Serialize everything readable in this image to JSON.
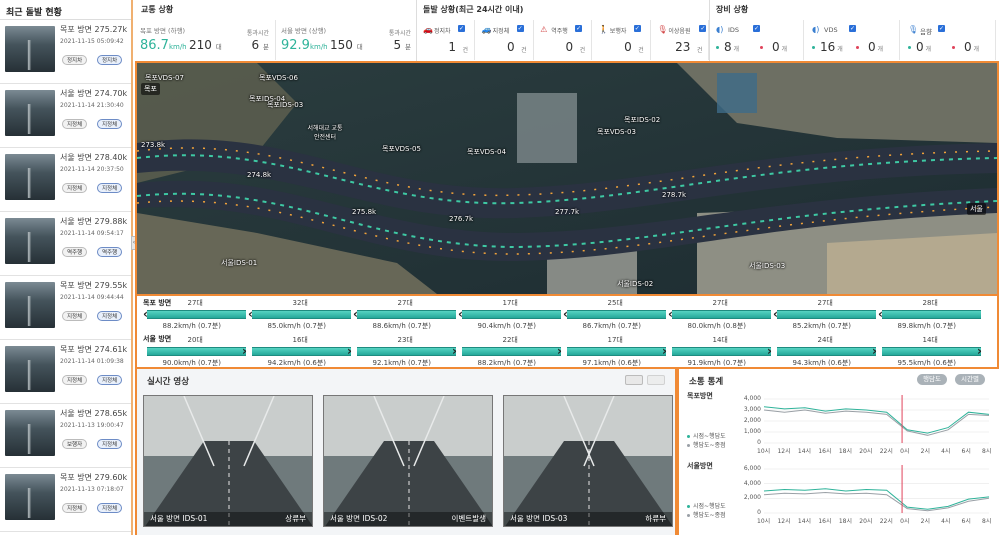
{
  "left_panel": {
    "title": "최근 돌발 현황",
    "incidents": [
      {
        "title": "목포 방면 275.27k",
        "date": "2021-11-15 05:09:42",
        "tags": [
          "정지차",
          "정지차"
        ]
      },
      {
        "title": "서울 방면 274.70k",
        "date": "2021-11-14 21:30:40",
        "tags": [
          "지정체",
          "지정체"
        ]
      },
      {
        "title": "서울 방면 278.40k",
        "date": "2021-11-14 20:37:50",
        "tags": [
          "지정체",
          "지정체"
        ]
      },
      {
        "title": "서울 방면 279.88k",
        "date": "2021-11-14 09:54:17",
        "tags": [
          "역주행",
          "역주행"
        ]
      },
      {
        "title": "목포 방면 279.55k",
        "date": "2021-11-14 09:44:44",
        "tags": [
          "지정체",
          "지정체"
        ]
      },
      {
        "title": "목포 방면 274.61k",
        "date": "2021-11-14 01:09:38",
        "tags": [
          "지정체",
          "지정체"
        ]
      },
      {
        "title": "서울 방면 278.65k",
        "date": "2021-11-13 19:00:47",
        "tags": [
          "보행자",
          "지정체"
        ]
      },
      {
        "title": "목포 방면 279.60k",
        "date": "2021-11-13 07:18:07",
        "tags": [
          "지정체",
          "지정체"
        ]
      }
    ]
  },
  "traffic": {
    "title": "교통 상황",
    "mokpo": {
      "label": "목포 방면 (하행)",
      "speed": "86.7",
      "speed_unit": "km/h",
      "count": "210",
      "count_unit": "대",
      "time_label": "통과시간",
      "time": "6",
      "time_unit": "분"
    },
    "seoul": {
      "label": "서울 방면 (상행)",
      "speed": "92.9",
      "speed_unit": "km/h",
      "count": "150",
      "count_unit": "대",
      "time_label": "통과시간",
      "time": "5",
      "time_unit": "분"
    }
  },
  "incidents_summary": {
    "title": "돌발 상황(최근 24시간 이내)",
    "items": [
      {
        "label": "정지차",
        "icon": "car-icon",
        "value": "1",
        "unit": "건"
      },
      {
        "label": "지정체",
        "icon": "traffic-jam-icon",
        "value": "0",
        "unit": "건"
      },
      {
        "label": "역주행",
        "icon": "warning-icon",
        "value": "0",
        "unit": "건"
      },
      {
        "label": "보행자",
        "icon": "pedestrian-icon",
        "value": "0",
        "unit": "건"
      },
      {
        "label": "이상음원",
        "icon": "microphone-icon",
        "value": "23",
        "unit": "건"
      }
    ]
  },
  "equipment": {
    "title": "장비 상황",
    "items": [
      {
        "label": "IDS",
        "icon": "ids-icon",
        "ok": "8",
        "err": "0",
        "unit": "개"
      },
      {
        "label": "VDS",
        "icon": "vds-icon",
        "ok": "16",
        "err": "0",
        "unit": "개"
      },
      {
        "label": "음향",
        "icon": "sound-icon",
        "ok": "0",
        "err": "0",
        "unit": "개"
      }
    ],
    "ok_color": "#2fb39a",
    "err_color": "#e0435a"
  },
  "map": {
    "labels": [
      "목포VDS-07",
      "목포VDS-06",
      "목포IDS-04",
      "목포IDS-03",
      "목포VDS-05",
      "목포VDS-04",
      "목포IDS-02",
      "목포VDS-03",
      "서울IDS-01",
      "서울IDS-02",
      "서울IDS-03",
      "서해대교 교통안전센터"
    ],
    "km_marks": [
      "274.8k",
      "275.8k",
      "276.7k",
      "277.7k",
      "278.7k",
      "273.8k"
    ],
    "left_dir": "목포",
    "right_dir": "서울"
  },
  "speed_bars": {
    "mokpo": {
      "label": "목포 방면",
      "counts": [
        "27대",
        "32대",
        "27대",
        "17대",
        "25대",
        "27대",
        "27대",
        "28대"
      ],
      "speeds": [
        "88.2km/h (0.7분)",
        "85.0km/h (0.7분)",
        "88.6km/h (0.7분)",
        "90.4km/h (0.7분)",
        "86.7km/h (0.7분)",
        "80.0km/h (0.8분)",
        "85.2km/h (0.7분)",
        "89.8km/h (0.7분)"
      ]
    },
    "seoul": {
      "label": "서울 방면",
      "counts": [
        "20대",
        "16대",
        "23대",
        "22대",
        "17대",
        "14대",
        "24대",
        "14대"
      ],
      "speeds": [
        "90.0km/h (0.7분)",
        "94.2km/h (0.6분)",
        "92.1km/h (0.7분)",
        "88.2km/h (0.7분)",
        "97.1km/h (0.6분)",
        "91.9km/h (0.7분)",
        "94.3km/h (0.6분)",
        "95.5km/h (0.6분)"
      ]
    }
  },
  "video": {
    "title": "실시간 영상",
    "cams": [
      {
        "name": "서울 방면 IDS-01",
        "dir": "상류부"
      },
      {
        "name": "서울 방면 IDS-02",
        "dir": "이벤트발생"
      },
      {
        "name": "서울 방면 IDS-03",
        "dir": "하류부"
      }
    ]
  },
  "stats": {
    "title": "소통 통계",
    "buttons": [
      "행담도",
      "시간별"
    ],
    "charts": [
      {
        "title": "목포방면",
        "legend": [
          "시점~행담도",
          "행담도~종점"
        ],
        "yticks": [
          "4,000",
          "3,000",
          "2,000",
          "1,000",
          "0"
        ],
        "xticks": [
          "10시",
          "12시",
          "14시",
          "16시",
          "18시",
          "20시",
          "22시",
          "0시",
          "2시",
          "4시",
          "6시",
          "8시"
        ]
      },
      {
        "title": "서울방면",
        "legend": [
          "시점~행담도",
          "행담도~종점"
        ],
        "yticks": [
          "6,000",
          "4,000",
          "2,000",
          "0"
        ],
        "xticks": [
          "10시",
          "12시",
          "14시",
          "16시",
          "18시",
          "20시",
          "22시",
          "0시",
          "2시",
          "4시",
          "6시",
          "8시"
        ]
      }
    ],
    "series_colors": [
      "#2fb39a",
      "#9aa0a6"
    ],
    "marker_color": "#e0435a"
  }
}
